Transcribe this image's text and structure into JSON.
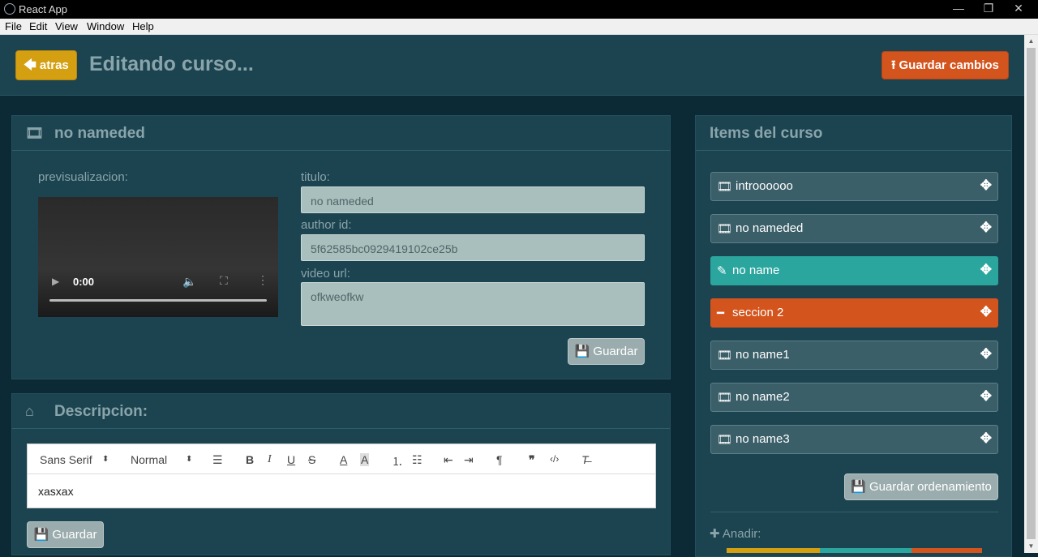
{
  "window": {
    "title": "React App",
    "minimize": "—",
    "restore": "❐",
    "close": "✕"
  },
  "menu": [
    "File",
    "Edit",
    "View",
    "Window",
    "Help"
  ],
  "header": {
    "back_label": "atras",
    "title": "Editando curso...",
    "save_all_label": "Guardar cambios"
  },
  "video_panel": {
    "title": "no nameded",
    "preview_label": "previsualizacion:",
    "video_time": "0:00",
    "titulo_label": "titulo:",
    "titulo_value": "no nameded",
    "author_label": "author id:",
    "author_value": "5f62585bc0929419102ce25b",
    "url_label": "video url:",
    "url_value": "ofkweofkw",
    "save_label": "Guardar"
  },
  "desc_panel": {
    "title": "Descripcion:",
    "font_select": "Sans Serif",
    "size_select": "Normal",
    "content": "xasxax",
    "save_label": "Guardar"
  },
  "items_panel": {
    "title": "Items del curso",
    "items": [
      {
        "label": "introooooo",
        "kind": "video"
      },
      {
        "label": "no nameded",
        "kind": "video"
      },
      {
        "label": "no name",
        "kind": "active"
      },
      {
        "label": "seccion 2",
        "kind": "section"
      },
      {
        "label": "no name1",
        "kind": "video"
      },
      {
        "label": "no name2",
        "kind": "video"
      },
      {
        "label": "no name3",
        "kind": "video"
      }
    ],
    "save_order_label": "Guardar ordenamiento",
    "add_label": "Anadir:"
  },
  "colors": {
    "back": "#d4a012",
    "save_all": "#d4541e",
    "active_item": "#2ba69f",
    "section_item": "#d3541d"
  }
}
